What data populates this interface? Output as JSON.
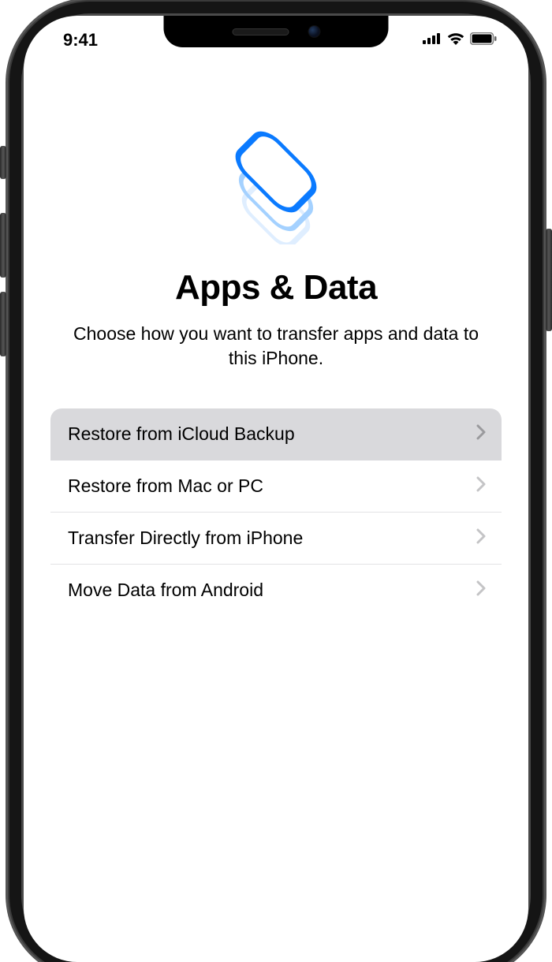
{
  "status_bar": {
    "time": "9:41"
  },
  "page": {
    "title": "Apps & Data",
    "subtitle": "Choose how you want to transfer apps and data to this iPhone."
  },
  "options": [
    {
      "label": "Restore from iCloud Backup",
      "selected": true
    },
    {
      "label": "Restore from Mac or PC",
      "selected": false
    },
    {
      "label": "Transfer Directly from iPhone",
      "selected": false
    },
    {
      "label": "Move Data from Android",
      "selected": false
    }
  ],
  "icons": {
    "hero": "layers-stack-icon",
    "signal": "cellular-signal-icon",
    "wifi": "wifi-icon",
    "battery": "battery-icon",
    "chevron": "chevron-right-icon"
  }
}
